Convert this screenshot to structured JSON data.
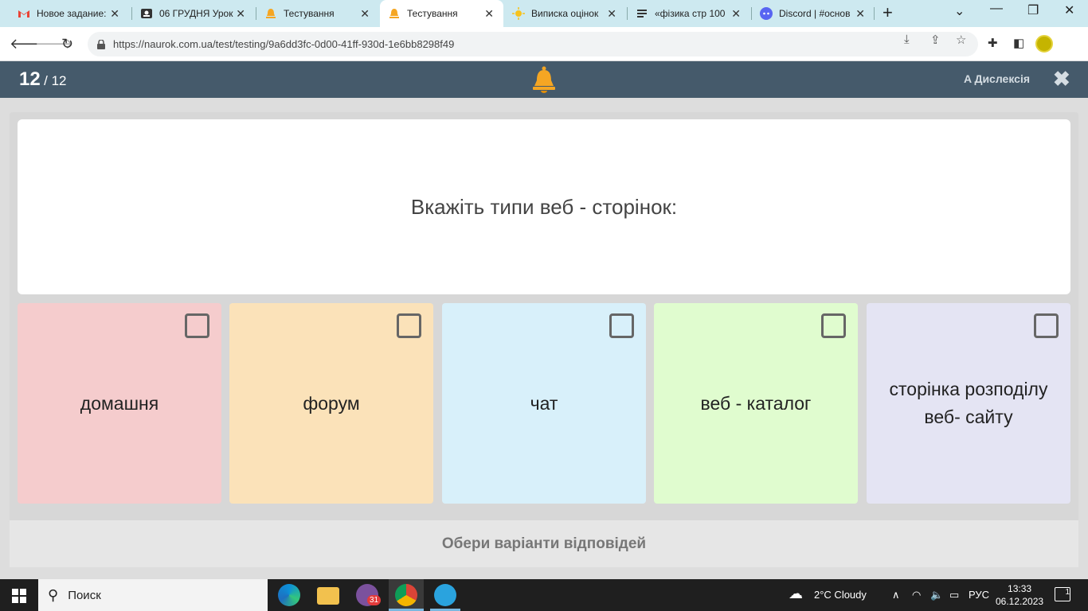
{
  "browser": {
    "tabs": [
      {
        "title": "Новое задание:",
        "icon": "gmail-icon",
        "active": false
      },
      {
        "title": "06 ГРУДНЯ Урок",
        "icon": "classroom-icon",
        "active": false
      },
      {
        "title": "Тестування",
        "icon": "naurok-bell-icon",
        "active": false
      },
      {
        "title": "Тестування",
        "icon": "naurok-bell-icon",
        "active": true
      },
      {
        "title": "Виписка оцінок",
        "icon": "sun-icon",
        "active": false
      },
      {
        "title": "«фізика стр 100",
        "icon": "docs-icon",
        "active": false
      },
      {
        "title": "Discord | #основ",
        "icon": "discord-icon",
        "active": false
      }
    ],
    "new_tab": "+",
    "url": "https://naurok.com.ua/test/testing/9a6dd3fc-0d00-41ff-930d-1e6bb8298f49"
  },
  "app": {
    "current_question": "12",
    "total_questions": "/ 12",
    "dyslexia_label": "A Дислексія",
    "close_symbol": "✖",
    "question_text": "Вкажіть типи веб - сторінок:",
    "options": [
      {
        "label": "домашня",
        "color": "#f5cccd"
      },
      {
        "label": "форум",
        "color": "#fbe2b9"
      },
      {
        "label": "чат",
        "color": "#d8f0fa"
      },
      {
        "label": "веб - каталог",
        "color": "#e0fccf"
      },
      {
        "label": "сторінка розподілу веб- сайту",
        "color": "#e4e4f3"
      }
    ],
    "footer_hint": "Обери варіанти відповідей",
    "accent_color": "#f5a623",
    "header_color": "#455a6b"
  },
  "taskbar": {
    "search_placeholder": "Поиск",
    "viber_badge": "31",
    "weather": "2°C  Cloudy",
    "language": "РУС",
    "time": "13:33",
    "date": "06.12.2023",
    "notification_count": "1"
  }
}
